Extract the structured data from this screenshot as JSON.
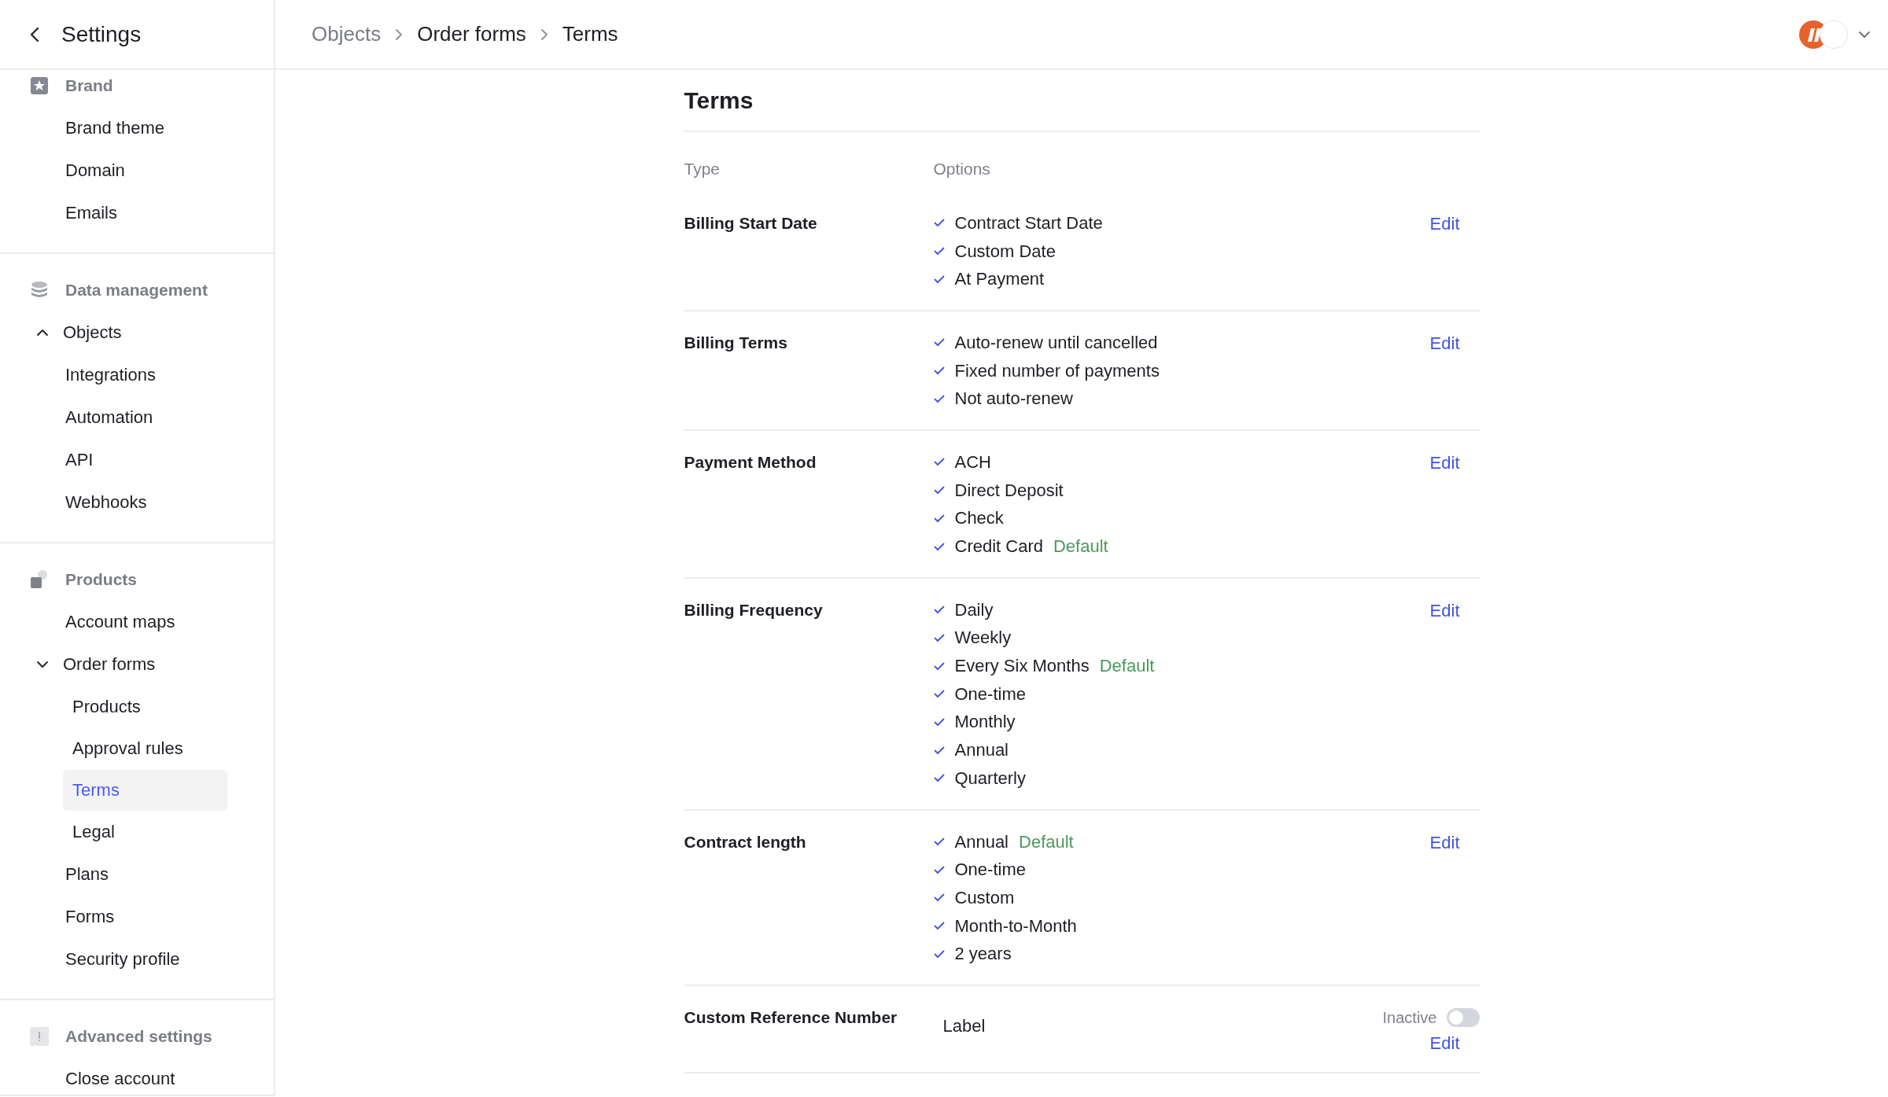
{
  "header": {
    "back": "Settings",
    "breadcrumb": [
      "Objects",
      "Order forms",
      "Terms"
    ]
  },
  "sidebar": {
    "sections": [
      {
        "title": "Brand",
        "kind": "brand",
        "items": [
          {
            "label": "Brand theme",
            "selected": false
          },
          {
            "label": "Domain",
            "selected": false
          },
          {
            "label": "Emails",
            "selected": false
          }
        ]
      },
      {
        "title": "Data management",
        "kind": "data",
        "items": [
          {
            "label": "Objects",
            "selected": false,
            "expanded": false
          },
          {
            "label": "Integrations",
            "selected": false
          },
          {
            "label": "Automation",
            "selected": false
          },
          {
            "label": "API",
            "selected": false
          },
          {
            "label": "Webhooks",
            "selected": false
          }
        ]
      },
      {
        "title": "Products",
        "kind": "products",
        "items": [
          {
            "label": "Account maps",
            "selected": false
          },
          {
            "label": "Order forms",
            "selected": false,
            "expanded": true,
            "children": [
              {
                "label": "Products",
                "selected": false
              },
              {
                "label": "Approval rules",
                "selected": false
              },
              {
                "label": "Terms",
                "selected": true
              },
              {
                "label": "Legal",
                "selected": false
              }
            ]
          },
          {
            "label": "Plans",
            "selected": false
          },
          {
            "label": "Forms",
            "selected": false
          },
          {
            "label": "Security profile",
            "selected": false
          }
        ]
      },
      {
        "title": "Advanced settings",
        "kind": "advanced",
        "items": [
          {
            "label": "Close account",
            "selected": false
          }
        ]
      }
    ]
  },
  "terms": {
    "title": "Terms",
    "columns": [
      "Type",
      "Options"
    ],
    "rows": [
      {
        "type": "Billing Start Date",
        "kind": "options",
        "edit": "Edit",
        "options": [
          {
            "label": "Contract Start Date",
            "checked": true
          },
          {
            "label": "Custom Date",
            "checked": true
          },
          {
            "label": "At Payment",
            "checked": true
          }
        ]
      },
      {
        "type": "Billing Terms",
        "kind": "options",
        "edit": "Edit",
        "options": [
          {
            "label": "Auto-renew until cancelled",
            "checked": true
          },
          {
            "label": "Fixed number of payments",
            "checked": true
          },
          {
            "label": "Not auto-renew",
            "checked": true
          }
        ]
      },
      {
        "type": "Payment Method",
        "kind": "options",
        "edit": "Edit",
        "options": [
          {
            "label": "ACH",
            "checked": true
          },
          {
            "label": "Direct Deposit",
            "checked": true
          },
          {
            "label": "Check",
            "checked": true
          },
          {
            "label": "Credit Card",
            "checked": true,
            "badge": "Default"
          }
        ]
      },
      {
        "type": "Billing Frequency",
        "kind": "options",
        "edit": "Edit",
        "options": [
          {
            "label": "Daily",
            "checked": true
          },
          {
            "label": "Weekly",
            "checked": true
          },
          {
            "label": "Every Six Months",
            "checked": true,
            "badge": "Default"
          },
          {
            "label": "One-time",
            "checked": true
          },
          {
            "label": "Monthly",
            "checked": true
          },
          {
            "label": "Annual",
            "checked": true
          },
          {
            "label": "Quarterly",
            "checked": true
          }
        ]
      },
      {
        "type": "Contract length",
        "kind": "options",
        "edit": "Edit",
        "options": [
          {
            "label": "Annual",
            "checked": true,
            "badge": "Default"
          },
          {
            "label": "One-time",
            "checked": true
          },
          {
            "label": "Custom",
            "checked": true
          },
          {
            "label": "Month-to-Month",
            "checked": true
          },
          {
            "label": "2 years",
            "checked": true
          }
        ]
      },
      {
        "type": "Custom Reference Number",
        "kind": "field",
        "edit": "Edit",
        "value": "Label",
        "status": "Inactive",
        "on": false
      }
    ]
  }
}
